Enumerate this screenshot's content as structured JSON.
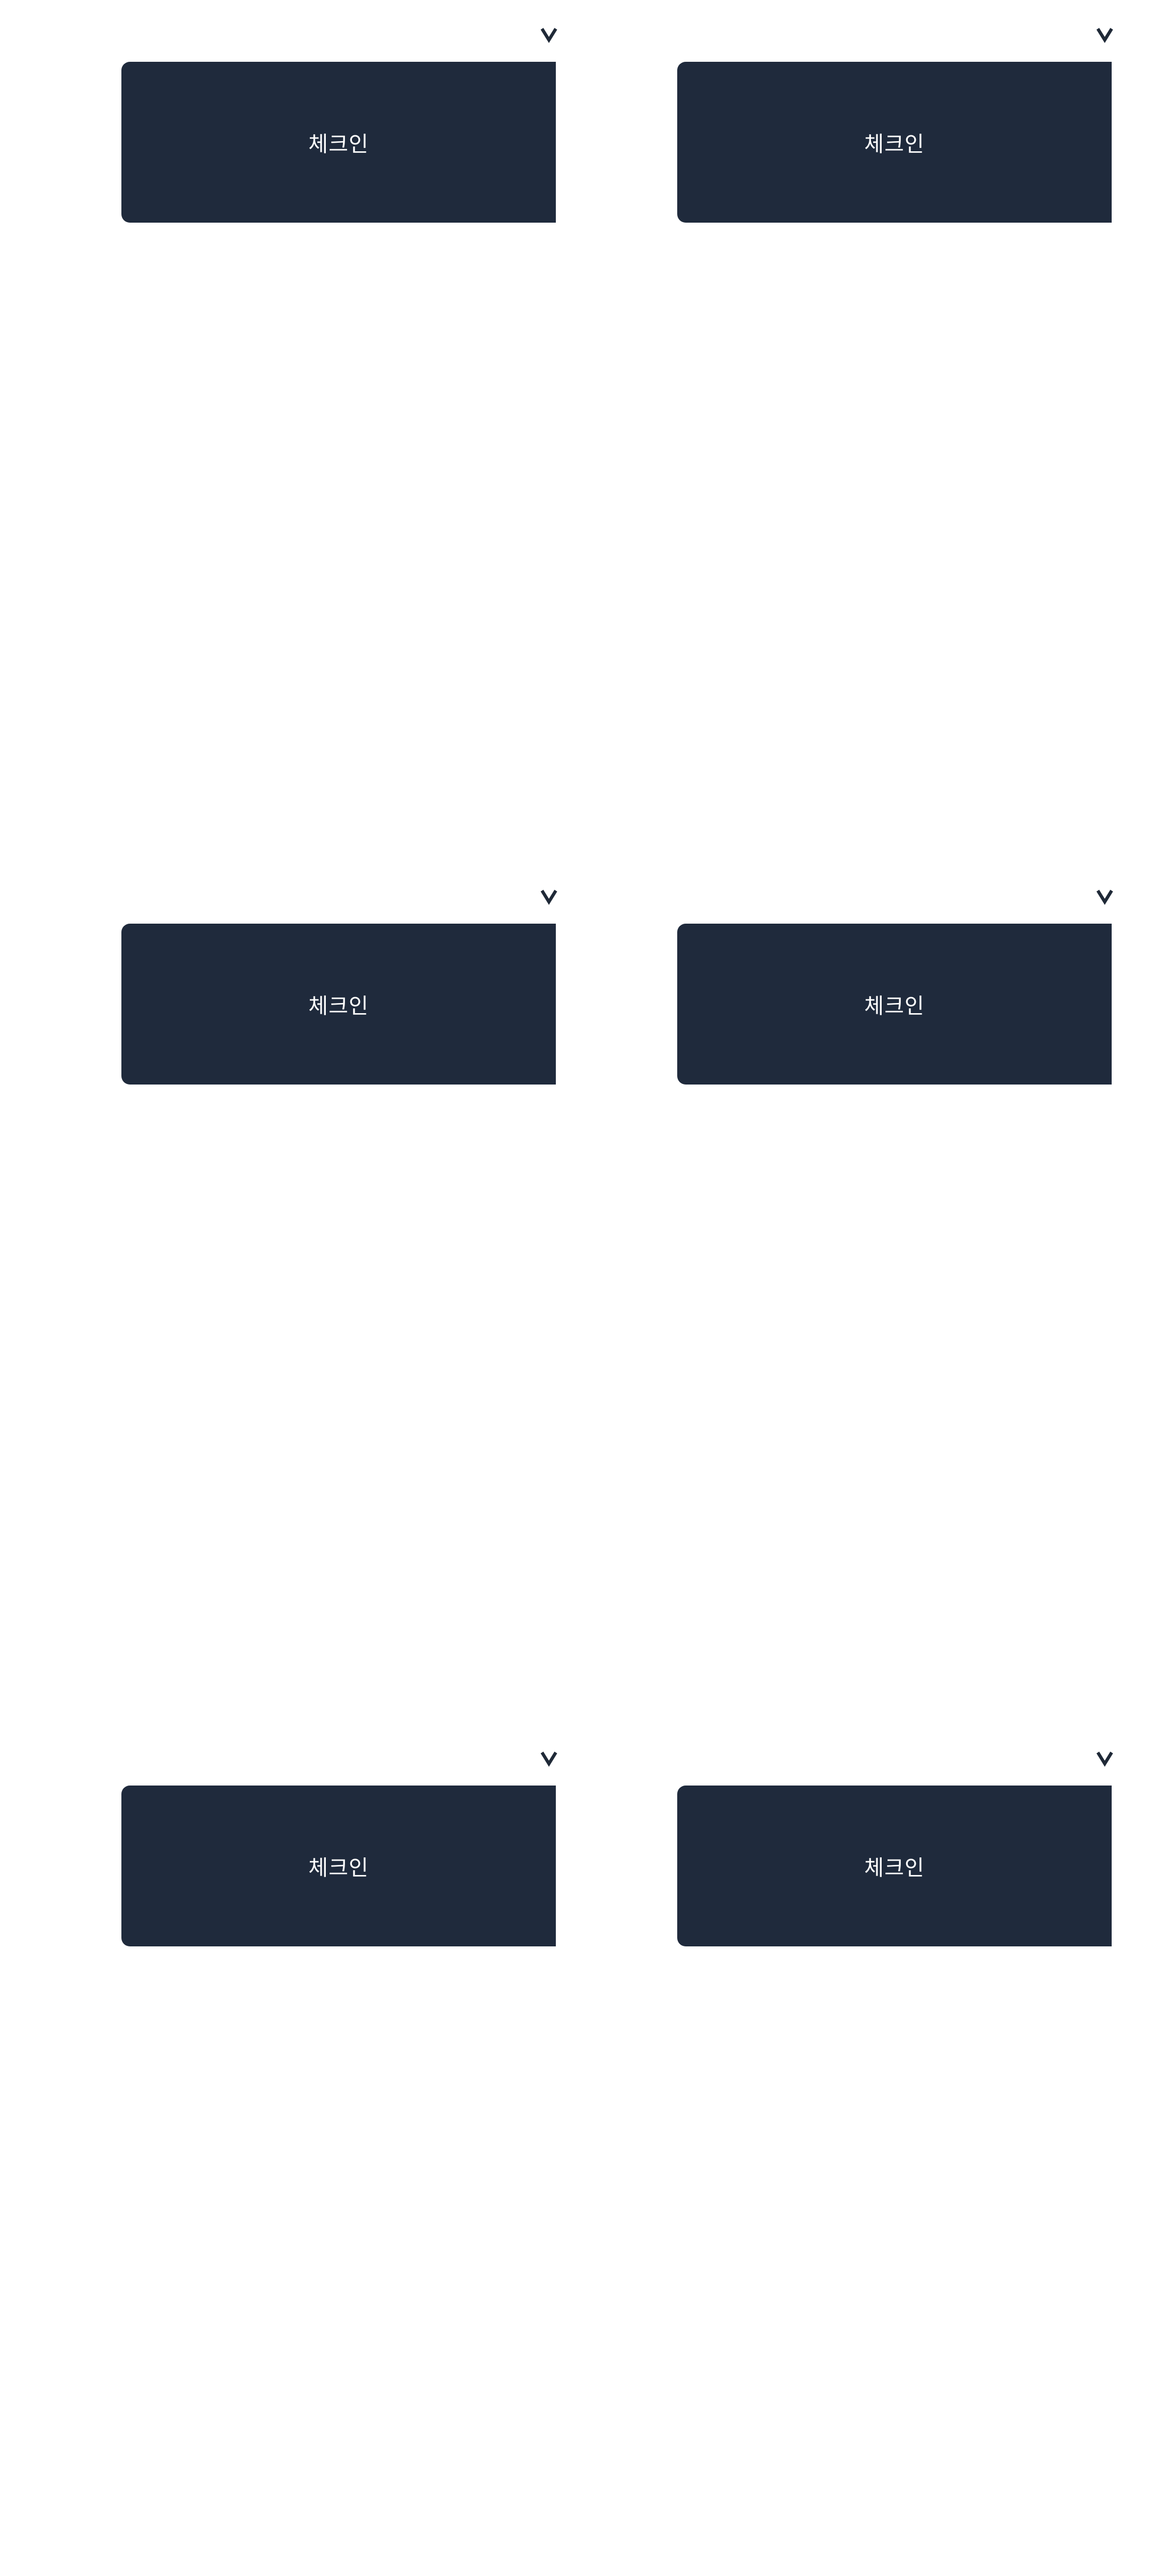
{
  "colors": {
    "background": "#ffffff",
    "button": "#1f2a3c",
    "button_text": "#ffffff",
    "chevron": "#1f2937"
  },
  "icons": {
    "chevron": "chevron-down-icon"
  },
  "cards": [
    {
      "button_label": "체크인"
    },
    {
      "button_label": "체크인"
    },
    {
      "button_label": "체크인"
    },
    {
      "button_label": "체크인"
    },
    {
      "button_label": "체크인"
    },
    {
      "button_label": "체크인"
    }
  ]
}
